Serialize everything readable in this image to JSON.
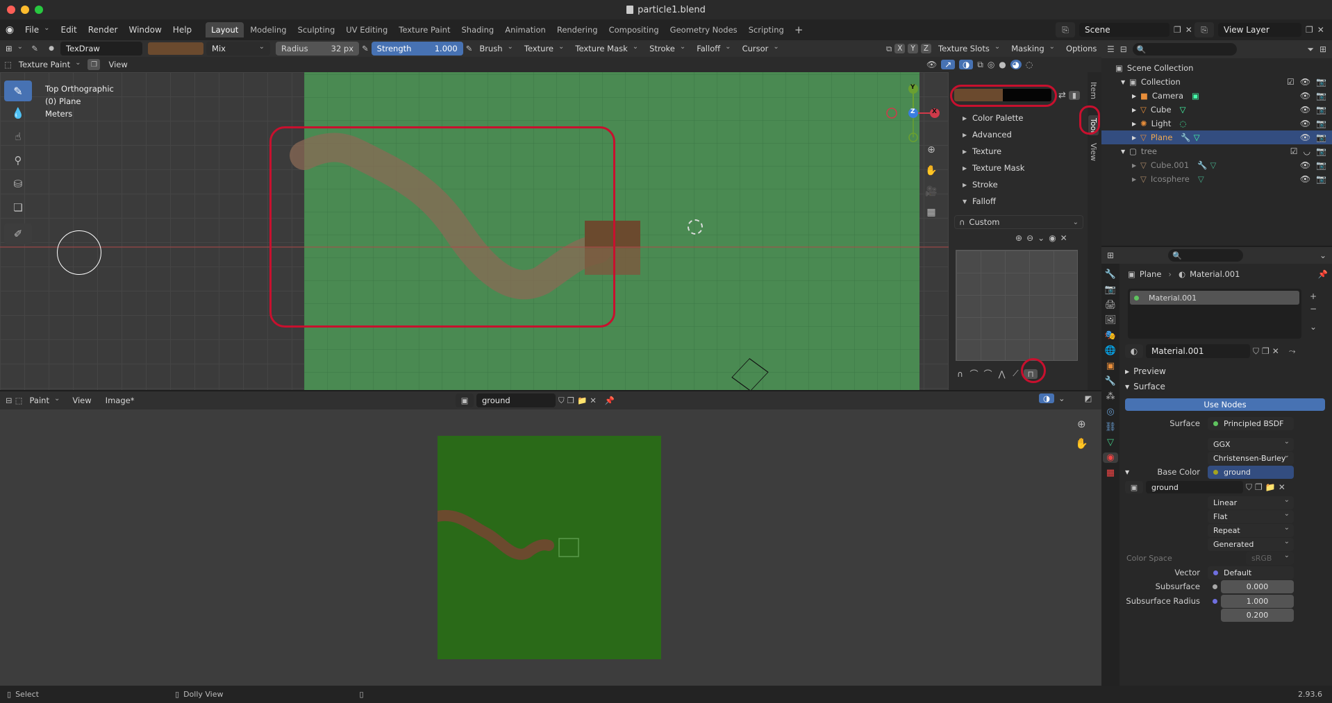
{
  "window": {
    "title": "particle1.blend"
  },
  "menu": {
    "items": [
      "File",
      "Edit",
      "Render",
      "Window",
      "Help"
    ]
  },
  "workspaces": [
    "Layout",
    "Modeling",
    "Sculpting",
    "UV Editing",
    "Texture Paint",
    "Shading",
    "Animation",
    "Rendering",
    "Compositing",
    "Geometry Nodes",
    "Scripting"
  ],
  "active_workspace": "Layout",
  "scene": {
    "name": "Scene",
    "view_layer": "View Layer"
  },
  "tool_header": {
    "brush_name": "TexDraw",
    "blend": "Mix",
    "radius_label": "Radius",
    "radius_value": "32 px",
    "strength_label": "Strength",
    "strength_value": "1.000",
    "menus": [
      "Brush",
      "Texture",
      "Texture Mask",
      "Stroke",
      "Falloff",
      "Cursor"
    ],
    "axes": [
      "X",
      "Y",
      "Z"
    ],
    "right_menus": [
      "Texture Slots",
      "Masking",
      "Options"
    ]
  },
  "viewport": {
    "mode": "Texture Paint",
    "view_menu": "View",
    "overlay_lines": [
      "Top Orthographic",
      "(0) Plane",
      "Meters"
    ],
    "gizmo_axes": [
      "Y",
      "Z",
      "X"
    ]
  },
  "sidebar": {
    "tabs": [
      "Item",
      "Tool",
      "View"
    ],
    "items": [
      "Color Palette",
      "Advanced",
      "Texture",
      "Texture Mask",
      "Stroke",
      "Falloff"
    ],
    "falloff_preset": "Custom"
  },
  "image_editor": {
    "mode": "Paint",
    "menus": [
      "View",
      "Image*"
    ],
    "image_name": "ground"
  },
  "outliner": {
    "root": "Scene Collection",
    "collection": "Collection",
    "objects": [
      "Camera",
      "Cube",
      "Light",
      "Plane"
    ],
    "tree_collection": "tree",
    "tree_objects": [
      "Cube.001",
      "Icosphere"
    ]
  },
  "properties": {
    "breadcrumb_object": "Plane",
    "breadcrumb_material": "Material.001",
    "slot": "Material.001",
    "material_name": "Material.001",
    "preview": "Preview",
    "surface_section": "Surface",
    "use_nodes": "Use Nodes",
    "surface_label": "Surface",
    "surface_value": "Principled BSDF",
    "distribution": "GGX",
    "subsurface_method": "Christensen-Burley",
    "base_color_label": "Base Color",
    "base_color_value": "ground",
    "image_name": "ground",
    "interpolation": "Linear",
    "projection": "Flat",
    "extension": "Repeat",
    "source": "Generated",
    "color_space_label": "Color Space",
    "color_space_value": "sRGB",
    "vector_label": "Vector",
    "vector_value": "Default",
    "subsurface_label": "Subsurface",
    "subsurface_value": "0.000",
    "subsurface_radius_label": "Subsurface Radius",
    "subsurface_radius_1": "1.000",
    "subsurface_radius_2": "0.200"
  },
  "status_bar": {
    "select": "Select",
    "dolly": "Dolly View",
    "version": "2.93.6"
  },
  "colors": {
    "brush_color": "#6b4a2e",
    "accent": "#4772b3",
    "annotation": "#c8102e",
    "texture_green": "#2a6a18"
  }
}
